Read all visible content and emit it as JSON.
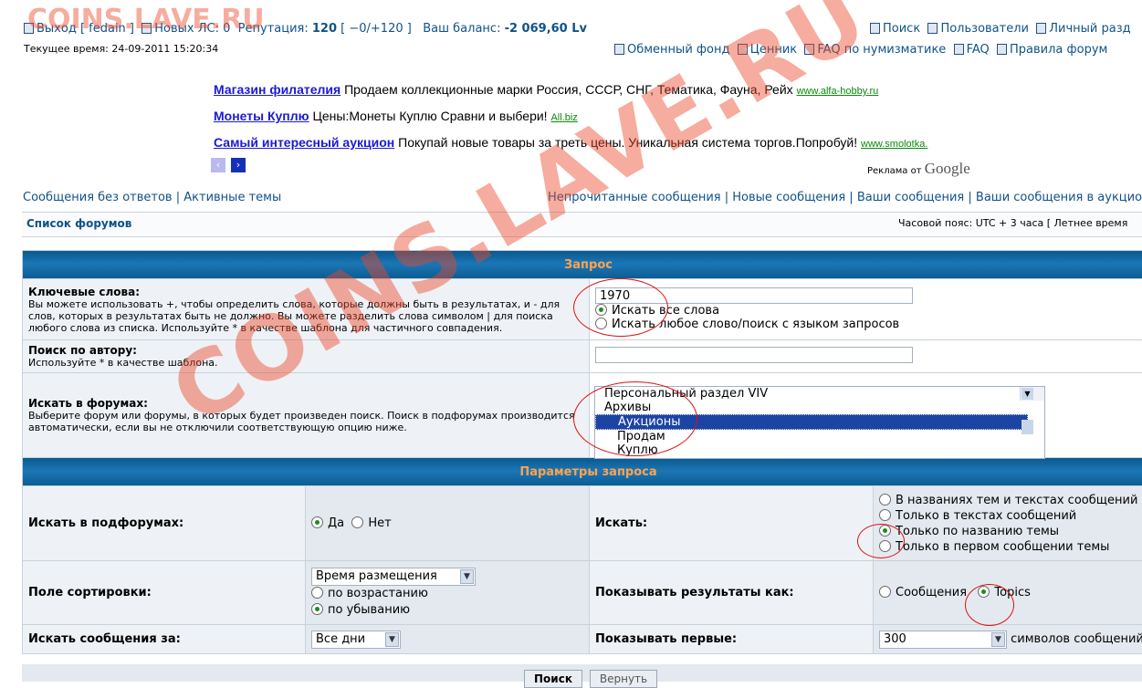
{
  "watermark_top": "COINS.LAVE.RU",
  "watermark_diag": "COINS.LAVE.RU",
  "topbar": {
    "logout": "Выход [ fedain ]",
    "new_pm": "Новых ЛС: 0",
    "reputation_label": "Репутация:",
    "reputation_value": "120",
    "reputation_detail": "[ −0/+120 ]",
    "balance_label": "Ваш баланс:",
    "balance_value": "-2 069,60 Lv",
    "current_time": "Текущее время: 24-09-2011 15:20:34",
    "links_row1": [
      "Поиск",
      "Пользователи",
      "Личный разд"
    ],
    "links_row2": [
      "Обменный фонд",
      "Ценник",
      "FAQ по нумизматике",
      "FAQ",
      "Правила форум"
    ]
  },
  "ads": [
    {
      "title": "Магазин филателия",
      "text": "Продаем коллекционные марки Россия, СССР, СНГ, Тематика, Фауна, Рейх",
      "url": "www.alfa-hobby.ru"
    },
    {
      "title": "Монеты Куплю",
      "text": "Цены:Монеты Куплю Сравни и выбери!",
      "url": "All.biz"
    },
    {
      "title": "Самый интересный аукцион",
      "text": "Покупай новые товары за треть цены. Уникальная система торгов.Попробуй!",
      "url": "www.smolotka."
    }
  ],
  "ads_by": "Реклама от",
  "ads_google": "Google",
  "nav": {
    "left": [
      "Сообщения без ответов",
      "Активные темы"
    ],
    "right": [
      "Непрочитанные сообщения",
      "Новые сообщения",
      "Ваши сообщения",
      "Ваши сообщения в аукцион"
    ]
  },
  "breadcrumb": "Список форумов",
  "timezone": "Часовой пояс: UTC + 3 часа [ Летнее время",
  "form": {
    "section1_title": "Запрос",
    "keywords_label": "Ключевые слова:",
    "keywords_help": "Вы можете использовать +, чтобы определить слова, которые должны быть в результатах, и - для слов, которых в результатах быть не должно. Вы можете разделить слова символом | для поиска любого слова из списка. Используйте * в качестве шаблона для частичного совпадения.",
    "keywords_value": "1970",
    "terms_all": "Искать все слова",
    "terms_any": "Искать любое слово/поиск с языком запросов",
    "author_label": "Поиск по автору:",
    "author_help": "Используйте * в качестве шаблона.",
    "author_value": "",
    "forums_label": "Искать в форумах:",
    "forums_help": "Выберите форум или форумы, в которых будет произведен поиск. Поиск в подфорумах производится автоматически, если вы не отключили соответствующую опцию ниже.",
    "forum_list": [
      "Персональный раздел VIV",
      "Архивы",
      "Аукционы",
      "Продам",
      "Куплю"
    ],
    "forum_selected": "Аукционы",
    "section2_title": "Параметры запроса",
    "subforums_label": "Искать в подфорумах:",
    "yes": "Да",
    "no": "Нет",
    "search_in_label": "Искать:",
    "search_in_options": [
      "В названиях тем и текстах сообщений",
      "Только в текстах сообщений",
      "Только по названию темы",
      "Только в первом сообщении темы"
    ],
    "search_in_selected": "Только по названию темы",
    "sort_label": "Поле сортировки:",
    "sort_field": "Время размещения",
    "asc": "по возрастанию",
    "desc": "по убыванию",
    "show_as_label": "Показывать результаты как:",
    "show_posts": "Сообщения",
    "show_topics": "Topics",
    "period_label": "Искать сообщения за:",
    "period_value": "Все дни",
    "show_first_label": "Показывать первые:",
    "show_first_value": "300",
    "chars_suffix": "символов сообщений",
    "search_btn": "Поиск",
    "reset_btn": "Вернуть"
  }
}
